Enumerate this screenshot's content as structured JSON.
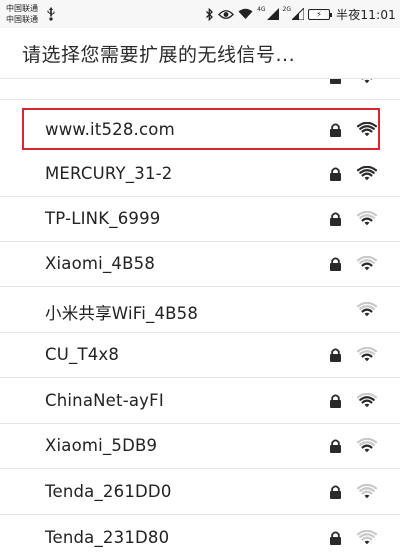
{
  "status_bar": {
    "carrier_1": "中国联通",
    "carrier_2": "中国联通",
    "signal_1_label": "4G",
    "signal_2_label": "2G",
    "time": "半夜11:01",
    "icons": [
      "usb-icon",
      "bluetooth-icon",
      "eye-icon",
      "wifi-status-icon",
      "signal-icon",
      "signal-icon",
      "battery-icon"
    ]
  },
  "header": {
    "title": "请选择您需要扩展的无线信号..."
  },
  "networks": [
    {
      "name": "",
      "locked": true,
      "signal": 3,
      "partial": true
    },
    {
      "name": "www.it528.com",
      "locked": true,
      "signal": 4,
      "highlighted": true
    },
    {
      "name": "MERCURY_31-2",
      "locked": true,
      "signal": 4
    },
    {
      "name": "TP-LINK_6999",
      "locked": true,
      "signal": 2
    },
    {
      "name": "Xiaomi_4B58",
      "locked": true,
      "signal": 2
    },
    {
      "name": "小米共享WiFi_4B58",
      "locked": false,
      "signal": 2
    },
    {
      "name": "CU_T4x8",
      "locked": true,
      "signal": 2
    },
    {
      "name": "ChinaNet-ayFI",
      "locked": true,
      "signal": 3
    },
    {
      "name": "Xiaomi_5DB9",
      "locked": true,
      "signal": 2
    },
    {
      "name": "Tenda_261DD0",
      "locked": true,
      "signal": 1
    },
    {
      "name": "Tenda_231D80",
      "locked": true,
      "signal": 1
    }
  ],
  "colors": {
    "highlight": "#d9262c",
    "text": "#222222",
    "icon_active": "#2a2a2a",
    "icon_inactive": "#c8c8c8"
  }
}
